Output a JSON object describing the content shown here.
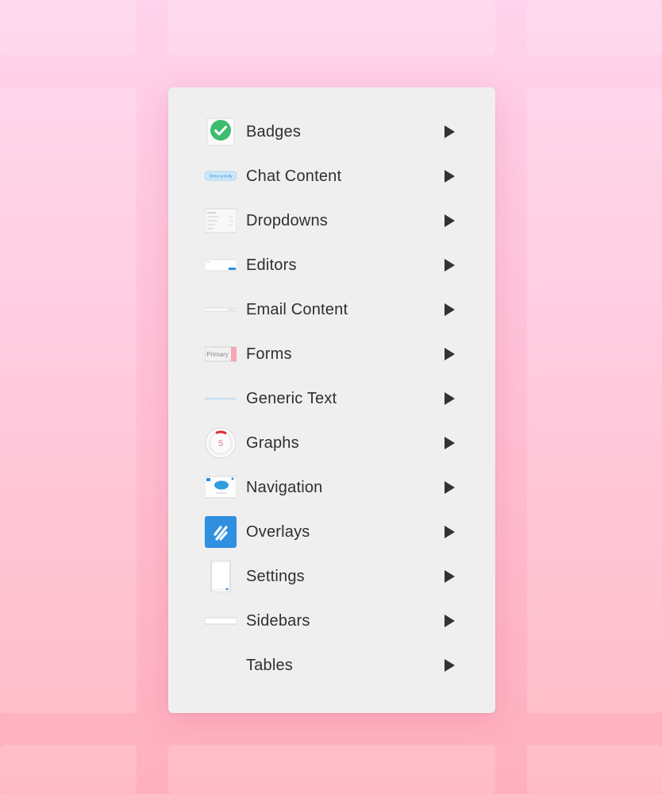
{
  "menu": {
    "items": [
      {
        "label": "Badges",
        "icon": "check-badge-icon"
      },
      {
        "label": "Chat Content",
        "icon": "chat-pill-icon",
        "thumb_text": "Show activity"
      },
      {
        "label": "Dropdowns",
        "icon": "dropdown-thumb-icon"
      },
      {
        "label": "Editors",
        "icon": "editor-thumb-icon"
      },
      {
        "label": "Email Content",
        "icon": "email-thumb-icon"
      },
      {
        "label": "Forms",
        "icon": "form-thumb-icon",
        "thumb_text": "Primary"
      },
      {
        "label": "Generic Text",
        "icon": "text-line-thumb-icon"
      },
      {
        "label": "Graphs",
        "icon": "donut-graph-icon",
        "thumb_text": "5"
      },
      {
        "label": "Navigation",
        "icon": "navigation-thumb-icon"
      },
      {
        "label": "Overlays",
        "icon": "overlay-logo-icon"
      },
      {
        "label": "Settings",
        "icon": "phone-thumb-icon"
      },
      {
        "label": "Sidebars",
        "icon": "sidebar-thumb-icon"
      },
      {
        "label": "Tables",
        "icon": "table-thumb-icon"
      }
    ],
    "submenu_arrow_icon": "triangle-right-icon"
  },
  "colors": {
    "badge_green": "#3dbb6e",
    "overlay_blue": "#2f8fe0",
    "accent_pink": "#e8778a"
  }
}
